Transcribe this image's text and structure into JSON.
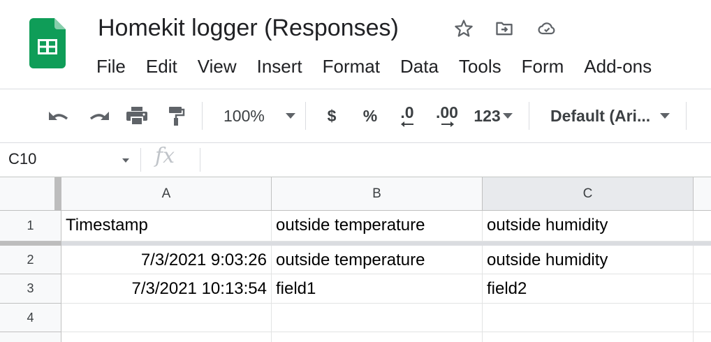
{
  "app": {
    "document_title": "Homekit logger (Responses)",
    "logo_icon": "google-sheets-logo",
    "brand_color": "#0f9d58"
  },
  "title_icons": [
    "star-icon",
    "move-to-folder-icon",
    "cloud-saved-icon"
  ],
  "menu": [
    "File",
    "Edit",
    "View",
    "Insert",
    "Format",
    "Data",
    "Tools",
    "Form",
    "Add-ons"
  ],
  "toolbar": {
    "undo_icon": "undo-icon",
    "redo_icon": "redo-icon",
    "print_icon": "print-icon",
    "paint_format_icon": "paint-format-icon",
    "zoom": "100%",
    "currency_label": "$",
    "percent_label": "%",
    "decrease_decimal_label": ".0",
    "increase_decimal_label": ".00",
    "number_format_label": "123",
    "font_label": "Default (Ari..."
  },
  "formula_bar": {
    "name_box": "C10",
    "fx_label": "fx",
    "formula_value": ""
  },
  "sheet": {
    "columns": [
      "A",
      "B",
      "C"
    ],
    "selected_column": "C",
    "rows": [
      {
        "number": "1",
        "cells": [
          "Timestamp",
          "outside temperature",
          "outside humidity"
        ]
      },
      {
        "number": "2",
        "cells": [
          "7/3/2021 9:03:26",
          "outside temperature",
          "outside humidity"
        ]
      },
      {
        "number": "3",
        "cells": [
          "7/3/2021 10:13:54",
          "field1",
          "field2"
        ]
      },
      {
        "number": "4",
        "cells": [
          "",
          "",
          ""
        ]
      }
    ]
  }
}
